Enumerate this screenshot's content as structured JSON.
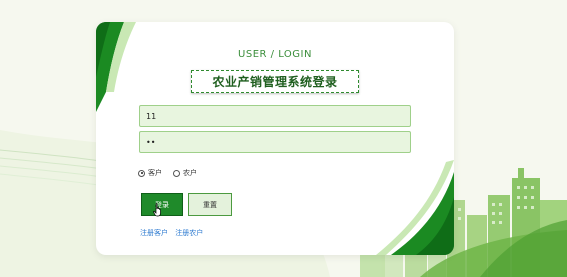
{
  "login": {
    "subtitle": "USER / LOGIN",
    "title": "农业产销管理系统登录",
    "username_value": "11",
    "password_value": "••",
    "roles": [
      "客户",
      "农户"
    ],
    "selected_role": "客户",
    "login_button": "登录",
    "reset_button": "重置",
    "register_customer": "注册客户",
    "register_farmer": "注册农户"
  },
  "colors": {
    "accent": "#1f8a2a",
    "background": "#f6f8ef",
    "field_bg": "#e8f5df",
    "link": "#2c7ad0"
  }
}
